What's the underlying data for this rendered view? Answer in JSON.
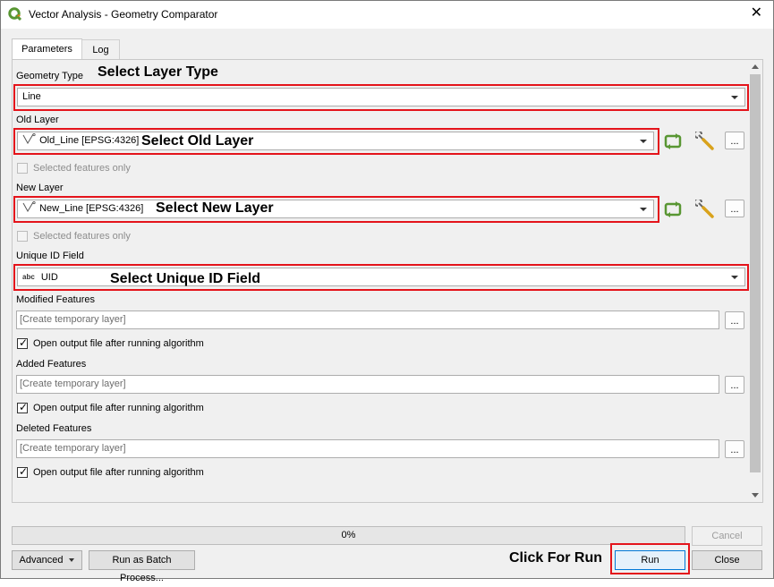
{
  "window": {
    "title": "Vector Analysis - Geometry Comparator",
    "close_glyph": "✕",
    "accent_green": "#589632",
    "annotation_red": "#e4141b"
  },
  "tabs": [
    {
      "label": "Parameters",
      "active": true
    },
    {
      "label": "Log",
      "active": false
    }
  ],
  "params": {
    "geometry_type": {
      "label": "Geometry Type",
      "value": "Line",
      "annotation": "Select Layer Type"
    },
    "old_layer": {
      "label": "Old Layer",
      "value": "Old_Line [EPSG:4326]",
      "annotation": "Select Old Layer",
      "selected_only_label": "Selected features only",
      "selected_only_checked": false
    },
    "new_layer": {
      "label": "New Layer",
      "value": "New_Line [EPSG:4326]",
      "annotation": "Select New Layer",
      "selected_only_label": "Selected features only",
      "selected_only_checked": false
    },
    "uid_field": {
      "label": "Unique ID Field",
      "value": "UID",
      "type_badge": "abc",
      "annotation": "Select Unique ID Field"
    },
    "modified": {
      "label": "Modified Features",
      "placeholder": "[Create temporary layer]",
      "open_label": "Open output file after running algorithm",
      "open_checked": true
    },
    "added": {
      "label": "Added Features",
      "placeholder": "[Create temporary layer]",
      "open_label": "Open output file after running algorithm",
      "open_checked": true
    },
    "deleted": {
      "label": "Deleted Features",
      "placeholder": "[Create temporary layer]",
      "open_label": "Open output file after running algorithm",
      "open_checked": true
    }
  },
  "dots_label": "...",
  "checkmark": "✓",
  "progress": {
    "value": 0,
    "text": "0%"
  },
  "footer": {
    "cancel_label": "Cancel",
    "advanced_label": "Advanced",
    "batch_label": "Run as Batch Process...",
    "run_label": "Run",
    "close_label": "Close",
    "run_annotation": "Click For Run"
  },
  "icons": {
    "app": "qgis-logo-icon",
    "line_layer": "line-layer-icon",
    "iterate": "iterate-features-icon",
    "wrench": "layer-settings-wrench-icon"
  }
}
